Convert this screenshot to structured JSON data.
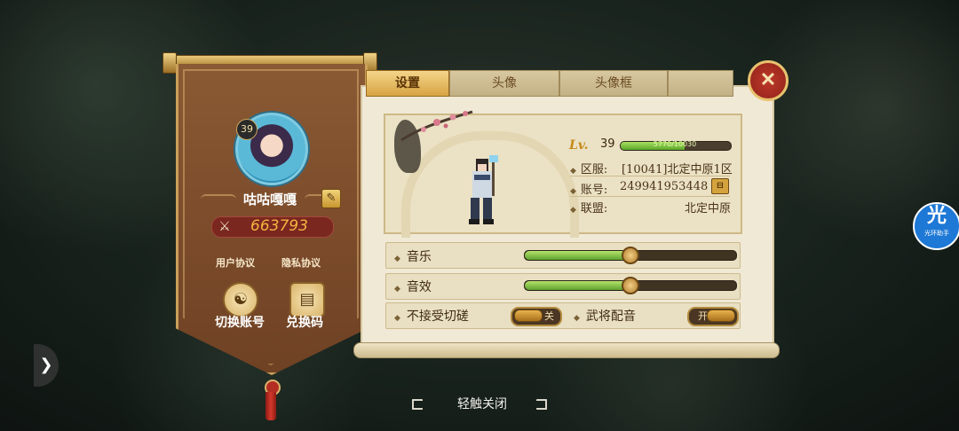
{
  "profile": {
    "avatar_level": "39",
    "nickname": "咕咕嘎嘎",
    "power": "663793",
    "user_agreement": "用户协议",
    "privacy_agreement": "隐私协议",
    "switch_account": "切换账号",
    "redeem_code": "兑换码"
  },
  "tabs": [
    {
      "label": "设置",
      "active": true
    },
    {
      "label": "头像",
      "active": false
    },
    {
      "label": "头像框",
      "active": false
    }
  ],
  "info": {
    "level_prefix": "Lv.",
    "level": "39",
    "exp_text": "5770/10030",
    "exp_fraction": 0.58,
    "server_label": "区服:",
    "server_value": "[10041]北定中原1区",
    "account_label": "账号:",
    "account_value": "249941953448",
    "alliance_label": "联盟:",
    "alliance_value": "北定中原"
  },
  "settings": {
    "music_label": "音乐",
    "music_level": 0.5,
    "sfx_label": "音效",
    "sfx_level": 0.5,
    "no_spar_label": "不接受切磋",
    "no_spar_state": "关",
    "voice_label": "武将配音",
    "voice_state": "开"
  },
  "hint": "轻触关闭",
  "assistant": {
    "glyph": "光",
    "label": "光环助手"
  },
  "colors": {
    "accent": "#d8a443",
    "panel": "#f0e9d6",
    "slider_fill": "#5ea12f",
    "close": "#c0392b"
  },
  "icons": [
    "edit-icon",
    "crossed-swords-icon",
    "switch-account-icon",
    "scroll-icon",
    "close-icon",
    "copy-icon",
    "chevron-right-icon"
  ]
}
